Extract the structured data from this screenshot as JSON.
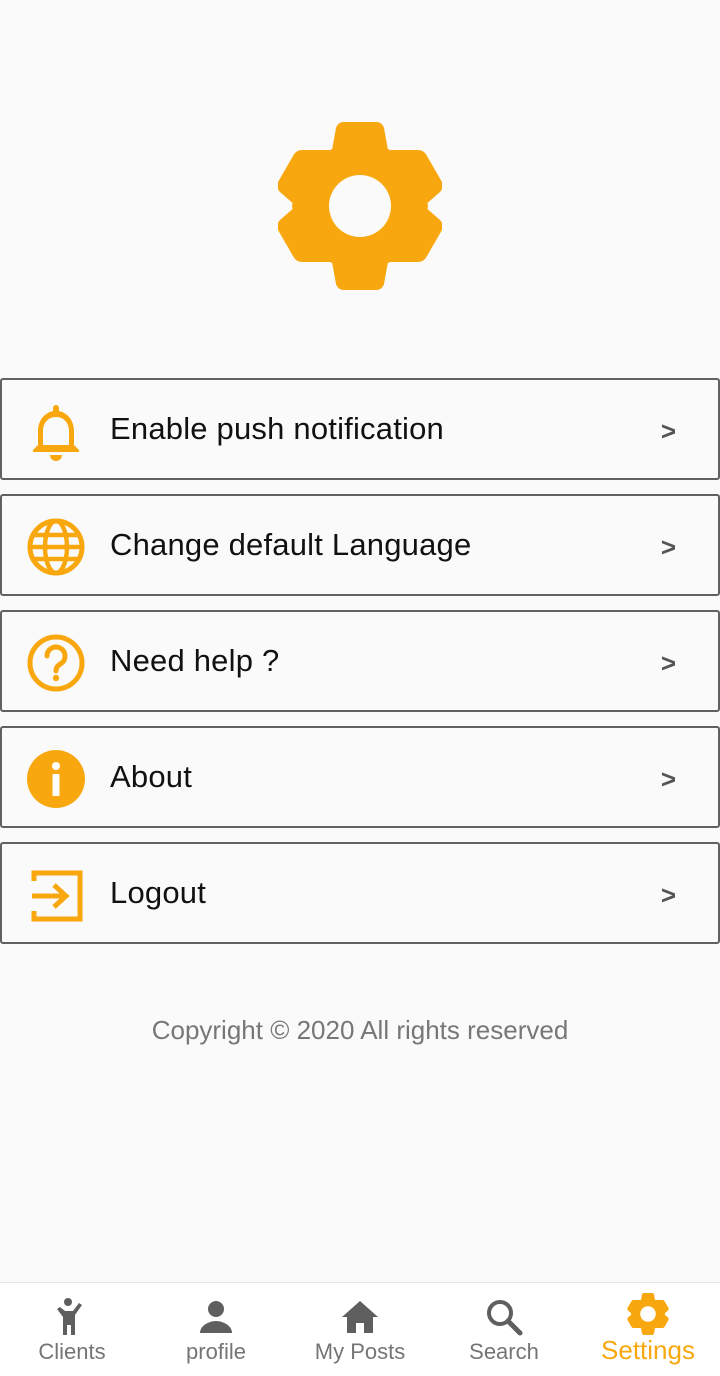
{
  "colors": {
    "accent": "#f8a80e",
    "text": "#111111",
    "muted": "#777777",
    "border": "#616161",
    "nav_inactive": "#757575"
  },
  "header": {
    "icon": "gear-icon"
  },
  "menu": {
    "items": [
      {
        "icon": "bell-icon",
        "label": "Enable push notification",
        "chevron": ">"
      },
      {
        "icon": "globe-icon",
        "label": "Change default Language",
        "chevron": ">"
      },
      {
        "icon": "help-icon",
        "label": "Need help ?",
        "chevron": ">"
      },
      {
        "icon": "info-icon",
        "label": "About",
        "chevron": ">"
      },
      {
        "icon": "logout-icon",
        "label": "Logout",
        "chevron": ">"
      }
    ]
  },
  "footer": {
    "copyright": "Copyright © 2020 All rights reserved"
  },
  "bottom_nav": {
    "active": "Settings",
    "items": [
      {
        "icon": "person-waving-icon",
        "label": "Clients"
      },
      {
        "icon": "person-icon",
        "label": "profile"
      },
      {
        "icon": "home-icon",
        "label": "My Posts"
      },
      {
        "icon": "search-icon",
        "label": "Search"
      },
      {
        "icon": "gear-icon",
        "label": "Settings"
      }
    ]
  }
}
